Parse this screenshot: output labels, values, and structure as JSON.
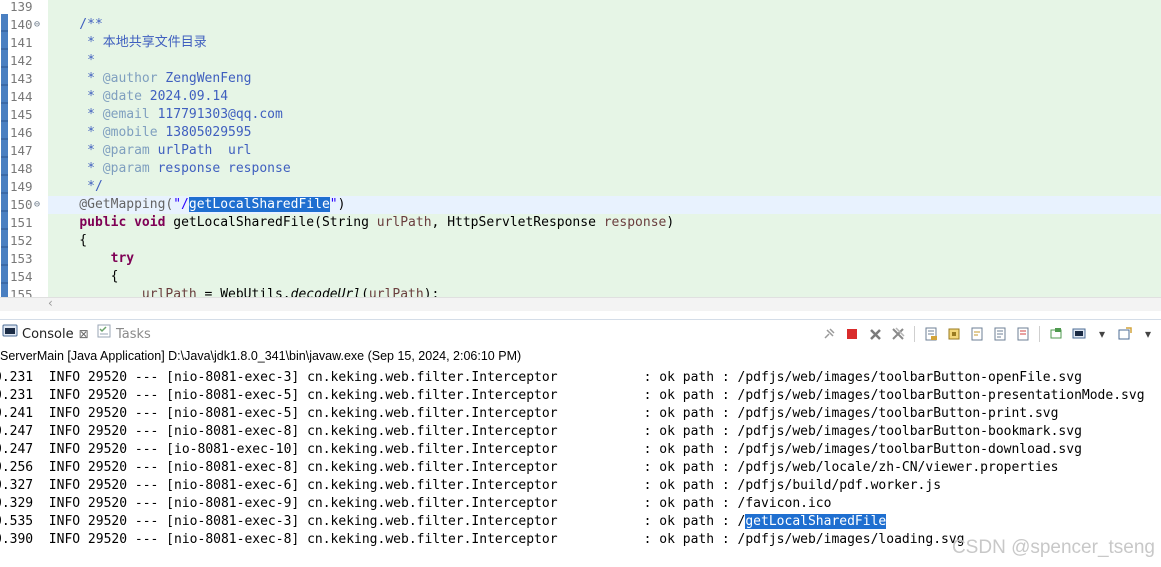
{
  "editor": {
    "lines": [
      {
        "num": "139",
        "fold": "",
        "segments": []
      },
      {
        "num": "140",
        "fold": "⊖",
        "segments": [
          {
            "t": "    /**",
            "c": "cmt"
          }
        ]
      },
      {
        "num": "141",
        "fold": "",
        "segments": [
          {
            "t": "     * 本地共享文件目录",
            "c": "cmt"
          }
        ]
      },
      {
        "num": "142",
        "fold": "",
        "segments": [
          {
            "t": "     *",
            "c": "cmt"
          }
        ]
      },
      {
        "num": "143",
        "fold": "",
        "segments": [
          {
            "t": "     * ",
            "c": "cmt"
          },
          {
            "t": "@author",
            "c": "tag"
          },
          {
            "t": " ZengWenFeng",
            "c": "cmt"
          }
        ]
      },
      {
        "num": "144",
        "fold": "",
        "segments": [
          {
            "t": "     * ",
            "c": "cmt"
          },
          {
            "t": "@date",
            "c": "tag"
          },
          {
            "t": " 2024.09.14",
            "c": "cmt"
          }
        ]
      },
      {
        "num": "145",
        "fold": "",
        "segments": [
          {
            "t": "     * ",
            "c": "cmt"
          },
          {
            "t": "@email",
            "c": "tag"
          },
          {
            "t": " 117791303@qq.com",
            "c": "cmt"
          }
        ]
      },
      {
        "num": "146",
        "fold": "",
        "segments": [
          {
            "t": "     * ",
            "c": "cmt"
          },
          {
            "t": "@mobile",
            "c": "tag"
          },
          {
            "t": " 13805029595",
            "c": "cmt"
          }
        ]
      },
      {
        "num": "147",
        "fold": "",
        "segments": [
          {
            "t": "     * ",
            "c": "cmt"
          },
          {
            "t": "@param",
            "c": "tag"
          },
          {
            "t": " urlPath  url",
            "c": "cmt"
          }
        ]
      },
      {
        "num": "148",
        "fold": "",
        "segments": [
          {
            "t": "     * ",
            "c": "cmt"
          },
          {
            "t": "@param",
            "c": "tag"
          },
          {
            "t": " response response",
            "c": "cmt"
          }
        ]
      },
      {
        "num": "149",
        "fold": "",
        "segments": [
          {
            "t": "     */",
            "c": "cmt"
          }
        ]
      },
      {
        "num": "150",
        "fold": "⊖",
        "highlight": true,
        "segments": [
          {
            "t": "    @GetMapping(",
            "c": "ann"
          },
          {
            "t": "\"/",
            "c": "str"
          },
          {
            "t": "getLocalSharedFile",
            "c": "sel"
          },
          {
            "t": "\"",
            "c": "str"
          },
          {
            "t": ")",
            "c": ""
          }
        ]
      },
      {
        "num": "151",
        "fold": "",
        "segments": [
          {
            "t": "    ",
            "c": ""
          },
          {
            "t": "public",
            "c": "kw"
          },
          {
            "t": " ",
            "c": ""
          },
          {
            "t": "void",
            "c": "kw"
          },
          {
            "t": " getLocalSharedFile(String ",
            "c": ""
          },
          {
            "t": "urlPath",
            "c": "param"
          },
          {
            "t": ", HttpServletResponse ",
            "c": ""
          },
          {
            "t": "response",
            "c": "param"
          },
          {
            "t": ")",
            "c": ""
          }
        ]
      },
      {
        "num": "152",
        "fold": "",
        "segments": [
          {
            "t": "    {",
            "c": ""
          }
        ]
      },
      {
        "num": "153",
        "fold": "",
        "segments": [
          {
            "t": "        ",
            "c": ""
          },
          {
            "t": "try",
            "c": "kw"
          }
        ]
      },
      {
        "num": "154",
        "fold": "",
        "segments": [
          {
            "t": "        {",
            "c": ""
          }
        ]
      },
      {
        "num": "155",
        "fold": "",
        "segments": [
          {
            "t": "            ",
            "c": ""
          },
          {
            "t": "urlPath",
            "c": "param"
          },
          {
            "t": " = WebUtils.",
            "c": ""
          },
          {
            "t": "decodeUrl",
            "c": "it"
          },
          {
            "t": "(",
            "c": ""
          },
          {
            "t": "urlPath",
            "c": "param"
          },
          {
            "t": ");",
            "c": ""
          }
        ]
      }
    ]
  },
  "tabs": {
    "console_label": "Console",
    "console_close": "⊠",
    "tasks_label": "Tasks"
  },
  "launch_info": "ServerMain [Java Application] D:\\Java\\jdk1.8.0_341\\bin\\javaw.exe (Sep 15, 2024, 2:06:10 PM)",
  "console": {
    "lines": [
      {
        "text": "0.231  INFO 29520 --- [nio-8081-exec-3] cn.keking.web.filter.Interceptor           : ok path : /pdfjs/web/images/toolbarButton-openFile.svg"
      },
      {
        "text": "0.231  INFO 29520 --- [nio-8081-exec-5] cn.keking.web.filter.Interceptor           : ok path : /pdfjs/web/images/toolbarButton-presentationMode.svg"
      },
      {
        "text": "0.241  INFO 29520 --- [nio-8081-exec-5] cn.keking.web.filter.Interceptor           : ok path : /pdfjs/web/images/toolbarButton-print.svg"
      },
      {
        "text": "0.247  INFO 29520 --- [nio-8081-exec-8] cn.keking.web.filter.Interceptor           : ok path : /pdfjs/web/images/toolbarButton-bookmark.svg"
      },
      {
        "text": "0.247  INFO 29520 --- [io-8081-exec-10] cn.keking.web.filter.Interceptor           : ok path : /pdfjs/web/images/toolbarButton-download.svg"
      },
      {
        "text": "0.256  INFO 29520 --- [nio-8081-exec-8] cn.keking.web.filter.Interceptor           : ok path : /pdfjs/web/locale/zh-CN/viewer.properties"
      },
      {
        "text": "0.327  INFO 29520 --- [nio-8081-exec-6] cn.keking.web.filter.Interceptor           : ok path : /pdfjs/build/pdf.worker.js"
      },
      {
        "text": "0.329  INFO 29520 --- [nio-8081-exec-9] cn.keking.web.filter.Interceptor           : ok path : /favicon.ico"
      },
      {
        "text": "0.535  INFO 29520 --- [nio-8081-exec-3] cn.keking.web.filter.Interceptor           : ok path : /",
        "sel": "getLocalSharedFile"
      },
      {
        "text": "0.390  INFO 29520 --- [nio-8081-exec-8] cn.keking.web.filter.Interceptor           : ok path : /pdfjs/web/images/loading.svg"
      }
    ]
  },
  "watermark": "CSDN @spencer_tseng",
  "colors": {
    "editor_bg": "#e6f5e6",
    "current_line": "#e8f2fe",
    "selection": "#1f6fd0",
    "comment": "#3f5fbf",
    "javadoc_tag": "#7f9fbf",
    "keyword": "#7f0055",
    "string": "#2a00ff"
  }
}
